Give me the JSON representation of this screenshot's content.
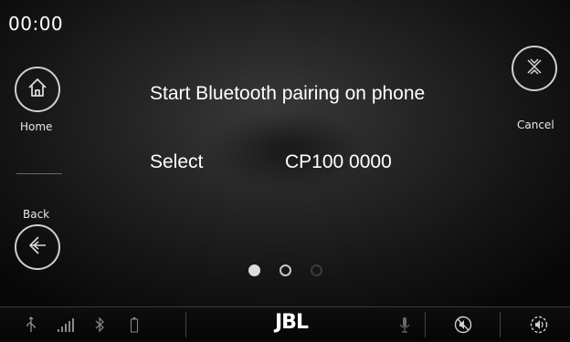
{
  "status": {
    "time": "00:00"
  },
  "nav": {
    "home_label": "Home",
    "back_label": "Back",
    "cancel_label": "Cancel"
  },
  "message": {
    "line1": "Start Bluetooth pairing on phone",
    "select_label": "Select",
    "device_name": "CP100 0000"
  },
  "pagination": {
    "total": 3,
    "active": 1
  },
  "status_bar": {
    "brand": "JBL",
    "icons": [
      "usb-icon",
      "signal-icon",
      "bluetooth-icon",
      "battery-icon",
      "microphone-icon",
      "mute-icon",
      "volume-icon"
    ]
  },
  "colors": {
    "background": "#000000",
    "text": "#ffffff",
    "icon": "#cfcfcf"
  }
}
